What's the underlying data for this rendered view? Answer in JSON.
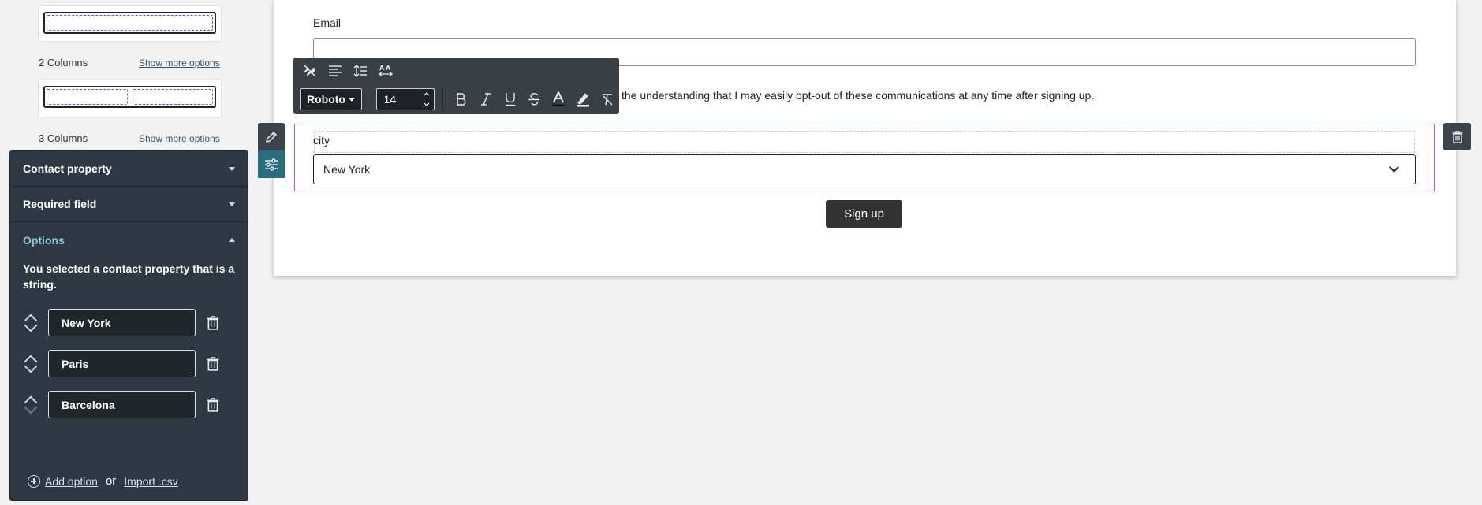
{
  "sidebar": {
    "columns": [
      {
        "label": "",
        "more": ""
      },
      {
        "label": "2 Columns",
        "more": "Show more options"
      },
      {
        "label": "3 Columns",
        "more": "Show more options"
      }
    ]
  },
  "panel": {
    "sections": [
      {
        "label": "Contact property",
        "open": false
      },
      {
        "label": "Required field",
        "open": false
      },
      {
        "label": "Options",
        "open": true
      }
    ],
    "description": "You selected a contact property that is a string.",
    "options": [
      "New York",
      "Paris",
      "Barcelona"
    ],
    "add_option": "Add option",
    "or_text": "or",
    "import_csv": "Import .csv"
  },
  "form": {
    "email_label": "Email",
    "email_value": "",
    "consent_text": "the understanding that I may easily opt-out of these communications at any time after signing up.",
    "city_label": "city",
    "city_value": "New York",
    "signup_label": "Sign up"
  },
  "toolbar": {
    "font": "Roboto",
    "size": "14",
    "format_buttons": [
      "bold",
      "italic",
      "underline",
      "strikethrough",
      "text-color",
      "highlight",
      "clear-format"
    ]
  },
  "colors": {
    "panel_bg": "#2d3842",
    "accent_teal": "#2b6d80",
    "selected_border": "#d04ccf",
    "button_dark": "#333333"
  }
}
